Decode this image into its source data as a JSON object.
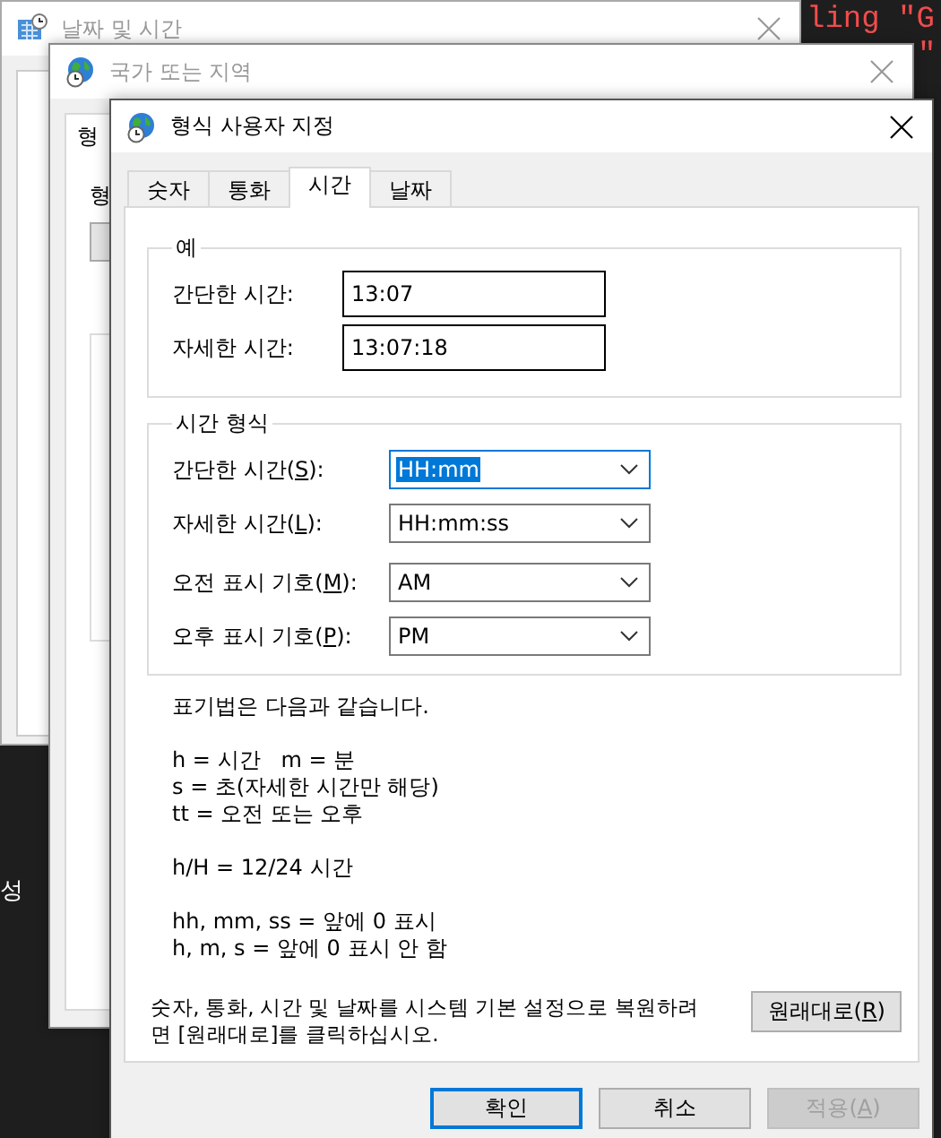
{
  "desktop": {
    "code_lines": [
      "ling \"G",
      "\""
    ],
    "side_text": "성"
  },
  "back_window": {
    "title": "날짜 및 시간",
    "active": false
  },
  "middle_window": {
    "title": "국가 또는 지역",
    "active": false,
    "tab": "형",
    "label": "형"
  },
  "dialog": {
    "title": "형식 사용자 지정",
    "active": true,
    "tabs": [
      {
        "label": "숫자",
        "selected": false
      },
      {
        "label": "통화",
        "selected": false
      },
      {
        "label": "시간",
        "selected": true
      },
      {
        "label": "날짜",
        "selected": false
      }
    ],
    "example": {
      "legend": "예",
      "rows": [
        {
          "label": "간단한 시간:",
          "value": "13:07"
        },
        {
          "label": "자세한 시간:",
          "value": "13:07:18"
        }
      ]
    },
    "format": {
      "legend": "시간 형식",
      "rows": [
        {
          "label_before": "간단한 시간(",
          "accel": "S",
          "label_after": "):",
          "value": "HH:mm",
          "focused": true
        },
        {
          "label_before": "자세한 시간(",
          "accel": "L",
          "label_after": "):",
          "value": "HH:mm:ss",
          "focused": false
        },
        {
          "label_before": "오전 표시 기호(",
          "accel": "M",
          "label_after": "):",
          "value": "AM",
          "focused": false
        },
        {
          "label_before": "오후 표시 기호(",
          "accel": "P",
          "label_after": "):",
          "value": "PM",
          "focused": false
        }
      ]
    },
    "notes": [
      [
        "표기법은 다음과 같습니다."
      ],
      [
        "h = 시간   m = 분",
        "s = 초(자세한 시간만 해당)",
        "tt = 오전 또는 오후"
      ],
      [
        "h/H = 12/24 시간"
      ],
      [
        "hh, mm, ss = 앞에 0 표시",
        "h, m, s = 앞에 0 표시 안 함"
      ]
    ],
    "restore": {
      "text": "숫자, 통화, 시간 및 날짜를 시스템 기본 설정으로 복원하려면 [원래대로]를 클릭하십시오.",
      "button": {
        "label_before": "원래대로(",
        "accel": "R",
        "label_after": ")",
        "disabled": false,
        "default": false
      }
    },
    "buttons": [
      {
        "label_before": "확인",
        "disabled": false,
        "default": true
      },
      {
        "label_before": "취소",
        "disabled": false,
        "default": false
      },
      {
        "label_before": "적용(",
        "accel": "A",
        "label_after": ")",
        "disabled": true,
        "default": false
      }
    ]
  }
}
